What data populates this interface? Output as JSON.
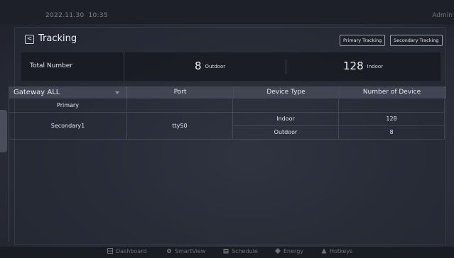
{
  "status_bar": {
    "date": "2022.11.30",
    "time": "10:35",
    "user": "Admin"
  },
  "header": {
    "back_label": "<",
    "title": "Tracking",
    "tabs": [
      "Primary Tracking",
      "Secondary Tracking"
    ]
  },
  "summary": {
    "label": "Total Number",
    "outdoor_value": "8",
    "outdoor_unit": "Outdoor",
    "indoor_value": "128",
    "indoor_unit": "Indoor"
  },
  "table": {
    "columns": [
      "Gateway ALL",
      "Port",
      "Device Type",
      "Number of Device"
    ],
    "primary_label": "Primary",
    "secondary_label": "Secondary1",
    "port": "ttyS0",
    "rows": [
      {
        "type": "Indoor",
        "count": "128"
      },
      {
        "type": "Outdoor",
        "count": "8"
      }
    ]
  },
  "nav": [
    "Dashboard",
    "SmartView",
    "Schedule",
    "Energy",
    "Hotkeys"
  ]
}
